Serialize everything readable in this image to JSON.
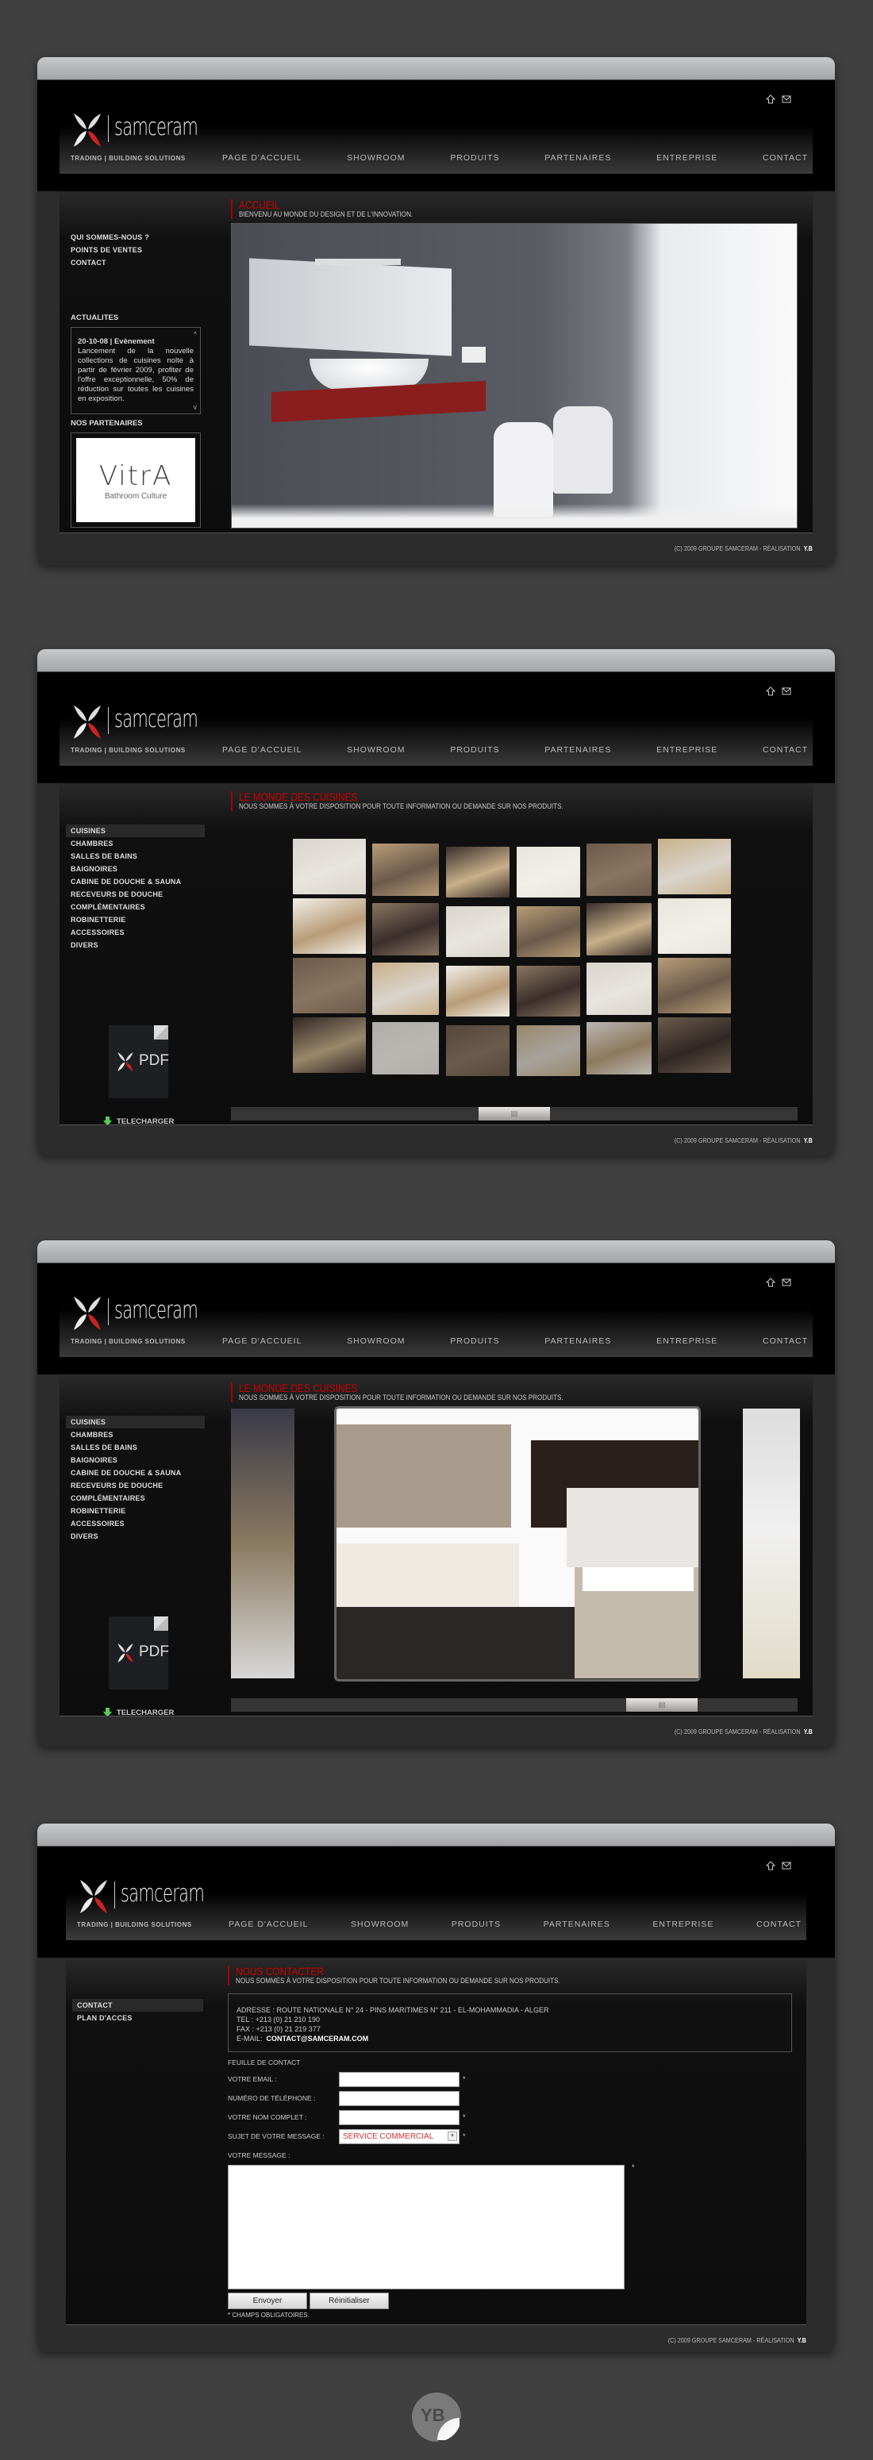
{
  "brand": {
    "name": "samceram",
    "tagline": "TRADING  |  BUILDING SOLUTIONS"
  },
  "header_icons": [
    "home-icon",
    "mail-icon"
  ],
  "nav": [
    "PAGE D'ACCUEIL",
    "SHOWROOM",
    "PRODUITS",
    "PARTENAIRES",
    "ENTREPRISE",
    "CONTACT"
  ],
  "footer": {
    "text": "(C) 2009 GROUPE SAMCERAM - RÉALISATION",
    "author": "Y.B"
  },
  "screen1": {
    "title": "ACCUEIL",
    "subtitle": "BIENVENU AU MONDE DU DESIGN ET DE L'INNOVATION.",
    "sidebar_links": [
      "QUI SOMMES-NOUS ?",
      "POINTS DE VENTES",
      "CONTACT"
    ],
    "news_label": "ACTUALITES",
    "news_date": "20-10-08 | Evènement",
    "news_text": "Lancement de la nouvelle collections de cuisines nolte à partir de février 2009, profiter de l'offre exceptionnelle, 50% de réduction sur toutes les cuisines en exposition.",
    "partners_label": "NOS PARTENAIRES",
    "partner_logo": "VitrA",
    "partner_tagline": "Bathroom Culture"
  },
  "products": {
    "title": "LE MONDE DES CUISINES",
    "subtitle": "NOUS SOMMES À VOTRE DISPOSITION POUR TOUTE INFORMATION OU DEMANDE SUR NOS PRODUITS.",
    "categories": [
      "CUISINES",
      "CHAMBRES",
      "SALLES DE BAINS",
      "BAIGNOIRES",
      "CABINE DE DOUCHE & SAUNA",
      "RECEVEURS DE DOUCHE",
      "COMPLÉMENTAIRES",
      "ROBINETTERIE",
      "ACCESSOIRES",
      "DIVERS"
    ],
    "active_category": "CUISINES",
    "pdf_label": "PDF",
    "download_label": "TELECHARGER",
    "scroll_grip": "||||"
  },
  "contact": {
    "title": "NOUS CONTACTER",
    "subtitle": "NOUS SOMMES À VOTRE DISPOSITION POUR TOUTE INFORMATION OU DEMANDE SUR NOS PRODUITS.",
    "sidebar_links": [
      "CONTACT",
      "PLAN D'ACCES"
    ],
    "address": "ADRESSE : ROUTE NATIONALE N° 24 - PINS MARITIMES N° 211 - EL-MOHAMMADIA - ALGER",
    "tel": "TEL : +213 (0) 21 210 190",
    "fax": "FAX : +213 (0) 21 219 377",
    "email_label": "E-MAIL:",
    "email": "CONTACT@SAMCERAM.COM",
    "form_title": "FEUILLE DE CONTACT",
    "fields": {
      "email": "VOTRE EMAIL :",
      "phone": "NUMÉRO DE TÉLÉPHONE :",
      "name": "VOTRE NOM COMPLET :",
      "subject": "SUJET DE VOTRE MESSAGE :",
      "message": "VOTRE MESSAGE :"
    },
    "subject_value": "SERVICE COMMERCIAL",
    "required_mark": "*",
    "send": "Envoyer",
    "reset": "Réinitialiser",
    "required_note": "* CHAMPS OBLIGATOIRES."
  },
  "badge": "YB"
}
